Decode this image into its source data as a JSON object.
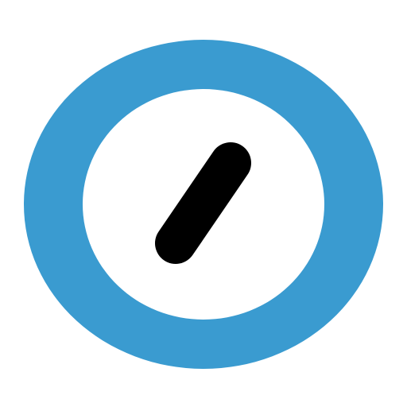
{
  "icon": {
    "name": "app-logo-icon",
    "colors": {
      "ring": "#3A9BD0",
      "inner": "#FFFFFF",
      "needle": "#000000",
      "background": "#FFFFFF"
    }
  }
}
